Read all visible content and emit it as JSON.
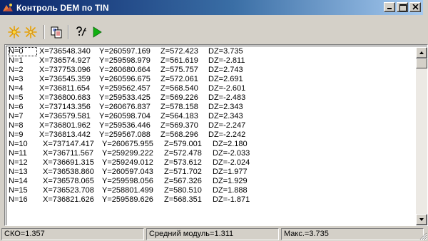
{
  "window": {
    "title": "Контроль DEM по TIN",
    "colors": {
      "titlebar_start": "#0a246a",
      "titlebar_end": "#a6caf0",
      "face": "#d4d0c8"
    }
  },
  "title_buttons": [
    "minimize-icon",
    "maximize-icon",
    "close-icon"
  ],
  "toolbar": {
    "tools": [
      {
        "icon": "sparkle-icon"
      },
      {
        "icon": "sparkle-icon"
      },
      {
        "icon": "copy-icon"
      },
      {
        "icon": "help-icon"
      },
      {
        "icon": "play-icon"
      }
    ]
  },
  "points": [
    {
      "n": "N=0",
      "x": "X=736548.340",
      "y": "Y=260597.169",
      "z": "Z=572.423",
      "dz": "DZ=3.735"
    },
    {
      "n": "N=1",
      "x": "X=736574.927",
      "y": "Y=259598.979",
      "z": "Z=561.619",
      "dz": "DZ=-2.811"
    },
    {
      "n": "N=2",
      "x": "X=737753.096",
      "y": "Y=260680.664",
      "z": "Z=575.757",
      "dz": "DZ=2.743"
    },
    {
      "n": "N=3",
      "x": "X=736545.359",
      "y": "Y=260596.675",
      "z": "Z=572.061",
      "dz": "DZ=2.691"
    },
    {
      "n": "N=4",
      "x": "X=736811.654",
      "y": "Y=259562.457",
      "z": "Z=568.540",
      "dz": "DZ=-2.601"
    },
    {
      "n": "N=5",
      "x": "X=736800.683",
      "y": "Y=259533.425",
      "z": "Z=569.226",
      "dz": "DZ=-2.483"
    },
    {
      "n": "N=6",
      "x": "X=737143.356",
      "y": "Y=260676.837",
      "z": "Z=578.158",
      "dz": "DZ=2.343"
    },
    {
      "n": "N=7",
      "x": "X=736579.581",
      "y": "Y=260598.704",
      "z": "Z=564.183",
      "dz": "DZ=2.343"
    },
    {
      "n": "N=8",
      "x": "X=736801.962",
      "y": "Y=259536.446",
      "z": "Z=569.370",
      "dz": "DZ=-2.247"
    },
    {
      "n": "N=9",
      "x": "X=736813.442",
      "y": "Y=259567.088",
      "z": "Z=568.296",
      "dz": "DZ=-2.242"
    },
    {
      "n": "N=10",
      "x": "X=737147.417",
      "y": "Y=260675.955",
      "z": "Z=579.001",
      "dz": "DZ=2.180"
    },
    {
      "n": "N=11",
      "x": "X=736711.567",
      "y": "Y=259299.222",
      "z": "Z=572.478",
      "dz": "DZ=-2.033"
    },
    {
      "n": "N=12",
      "x": "X=736691.315",
      "y": "Y=259249.012",
      "z": "Z=573.612",
      "dz": "DZ=-2.024"
    },
    {
      "n": "N=13",
      "x": "X=736538.860",
      "y": "Y=260597.043",
      "z": "Z=571.702",
      "dz": "DZ=1.977"
    },
    {
      "n": "N=14",
      "x": "X=736578.065",
      "y": "Y=259598.056",
      "z": "Z=567.326",
      "dz": "DZ=1.929"
    },
    {
      "n": "N=15",
      "x": "X=736523.708",
      "y": "Y=258801.499",
      "z": "Z=580.510",
      "dz": "DZ=1.888"
    },
    {
      "n": "N=16",
      "x": "X=736821.626",
      "y": "Y=259589.626",
      "z": "Z=568.351",
      "dz": "DZ=-1.871"
    }
  ],
  "status": {
    "rmse": "СКО=1.357",
    "mean_abs": "Средний модуль=1.311",
    "max": "Макс.=3.735"
  }
}
